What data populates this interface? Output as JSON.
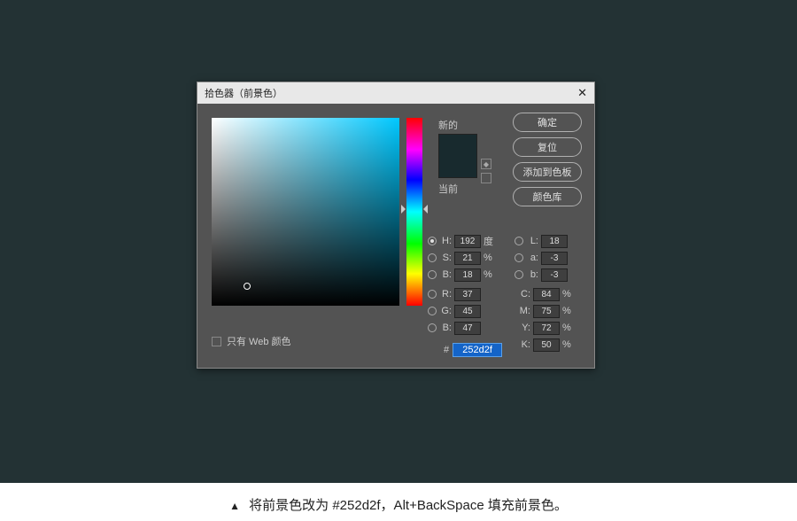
{
  "dialog": {
    "title": "拾色器（前景色）",
    "swatch": {
      "new_label": "新的",
      "current_label": "当前",
      "new_color": "#182a2e",
      "current_color": "#182a2e"
    },
    "buttons": {
      "ok": "确定",
      "reset": "复位",
      "add": "添加到色板",
      "library": "颜色库"
    },
    "webonly_label": "只有 Web 颜色",
    "hex": {
      "prefix": "#",
      "value": "252d2f"
    },
    "hsb": {
      "h_label": "H:",
      "h_value": "192",
      "h_unit": "度",
      "s_label": "S:",
      "s_value": "21",
      "s_unit": "%",
      "b_label": "B:",
      "b_value": "18",
      "b_unit": "%"
    },
    "lab": {
      "l_label": "L:",
      "l_value": "18",
      "a_label": "a:",
      "a_value": "-3",
      "b_label": "b:",
      "b_value": "-3"
    },
    "rgb": {
      "r_label": "R:",
      "r_value": "37",
      "g_label": "G:",
      "g_value": "45",
      "b_label": "B:",
      "b_value": "47"
    },
    "cmyk": {
      "c_label": "C:",
      "c_value": "84",
      "unit": "%",
      "m_label": "M:",
      "m_value": "75",
      "y_label": "Y:",
      "y_value": "72",
      "k_label": "K:",
      "k_value": "50"
    }
  },
  "caption": "将前景色改为 #252d2f，Alt+BackSpace 填充前景色。"
}
